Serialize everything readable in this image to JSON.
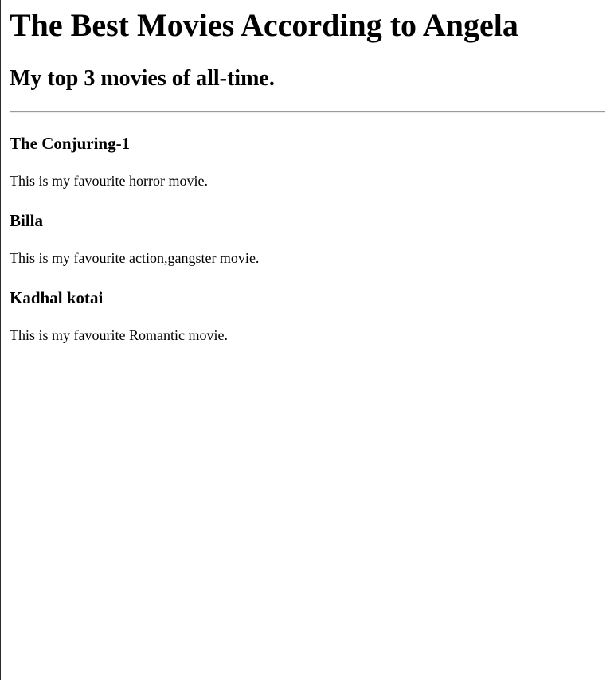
{
  "page": {
    "title": "The Best Movies According to Angela",
    "subtitle": "My top 3 movies of all-time."
  },
  "movies": [
    {
      "title": "The Conjuring-1",
      "description": "This is my favourite horror movie."
    },
    {
      "title": "Billa",
      "description": "This is my favourite action,gangster movie."
    },
    {
      "title": "Kadhal kotai",
      "description": "This is my favourite Romantic movie."
    }
  ]
}
